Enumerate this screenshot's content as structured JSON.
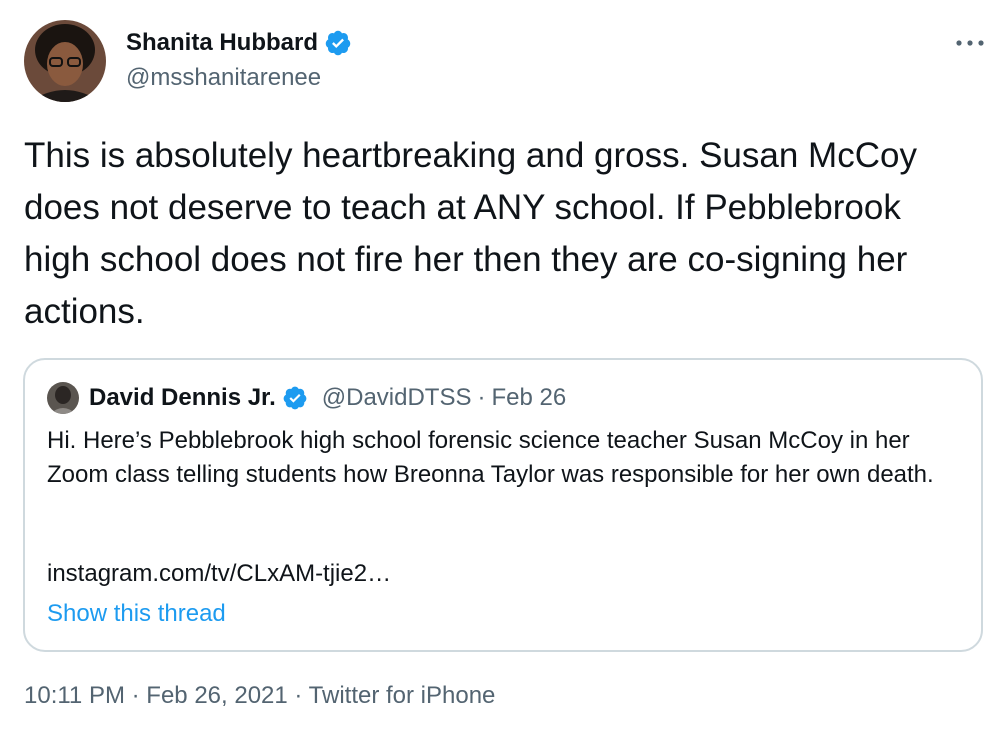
{
  "author": {
    "name": "Shanita Hubbard",
    "handle": "@msshanitarenee",
    "verified_icon": "verified-badge-icon",
    "avatar": "avatar"
  },
  "tweet": {
    "text": "This is absolutely heartbreaking and gross. Susan McCoy does not deserve to teach at ANY school. If Pebblebrook high school does not fire her then they are co-signing her actions."
  },
  "quote": {
    "name": "David Dennis Jr.",
    "handle": "@DavidDTSS",
    "separator": "·",
    "date": "Feb 26",
    "text": "Hi. Here’s Pebblebrook high school forensic science teacher Susan McCoy in her Zoom class telling students how Breonna Taylor was responsible for her own death.",
    "link": "instagram.com/tv/CLxAM-tjie2…",
    "show_thread": "Show this thread"
  },
  "meta": {
    "time": "10:11 PM",
    "sep1": "·",
    "date": "Feb 26, 2021",
    "sep2": "·",
    "source": "Twitter for iPhone"
  },
  "colors": {
    "text": "#0f1419",
    "secondary": "#536471",
    "link": "#1d9bf0",
    "verified": "#1d9bf0",
    "border": "#cfd9de"
  }
}
